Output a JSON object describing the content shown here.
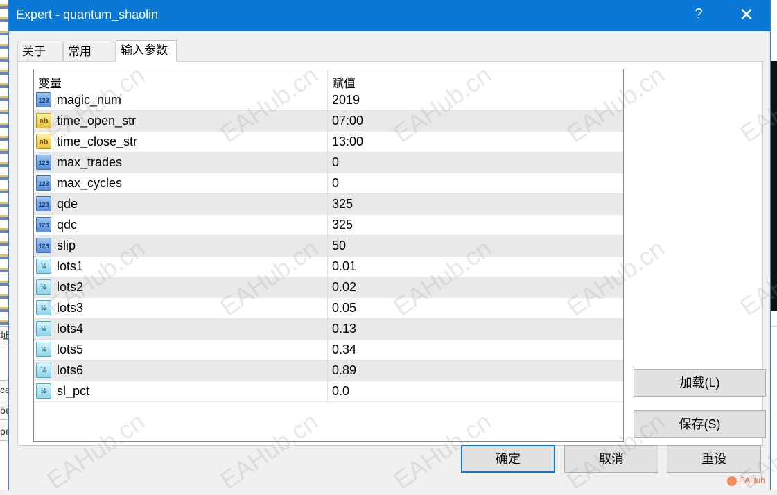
{
  "window": {
    "title": "Expert - quantum_shaolin",
    "help": "?",
    "close": "✕"
  },
  "tabs": [
    {
      "label": "关于"
    },
    {
      "label": "常用"
    },
    {
      "label": "输入参数"
    }
  ],
  "grid": {
    "headers": {
      "variable": "变量",
      "value": "赋值"
    },
    "rows": [
      {
        "type": "int",
        "icon": "123",
        "name": "magic_num",
        "value": "2019"
      },
      {
        "type": "string",
        "icon": "ab",
        "name": "time_open_str",
        "value": "07:00"
      },
      {
        "type": "string",
        "icon": "ab",
        "name": "time_close_str",
        "value": "13:00"
      },
      {
        "type": "int",
        "icon": "123",
        "name": "max_trades",
        "value": "0"
      },
      {
        "type": "int",
        "icon": "123",
        "name": "max_cycles",
        "value": "0"
      },
      {
        "type": "int",
        "icon": "123",
        "name": "qde",
        "value": "325"
      },
      {
        "type": "int",
        "icon": "123",
        "name": "qdc",
        "value": "325"
      },
      {
        "type": "int",
        "icon": "123",
        "name": "slip",
        "value": "50"
      },
      {
        "type": "double",
        "icon": "½",
        "name": "lots1",
        "value": "0.01"
      },
      {
        "type": "double",
        "icon": "½",
        "name": "lots2",
        "value": "0.02"
      },
      {
        "type": "double",
        "icon": "½",
        "name": "lots3",
        "value": "0.05"
      },
      {
        "type": "double",
        "icon": "½",
        "name": "lots4",
        "value": "0.13"
      },
      {
        "type": "double",
        "icon": "½",
        "name": "lots5",
        "value": "0.34"
      },
      {
        "type": "double",
        "icon": "½",
        "name": "lots6",
        "value": "0.89"
      },
      {
        "type": "double",
        "icon": "½",
        "name": "sl_pct",
        "value": "0.0"
      }
    ]
  },
  "buttons": {
    "load": "加载(L)",
    "save": "保存(S)",
    "ok": "确定",
    "cancel": "取消",
    "reset": "重设"
  },
  "watermark": "EAHub.cn",
  "corner_logo": "EAHub",
  "background": {
    "left_stubs": [
      "ce",
      "be",
      "be"
    ],
    "left_tab": "址"
  },
  "colors": {
    "titlebar": "#0a78d7",
    "alt_row": "#e9e9e9",
    "primary_border": "#0a78d7"
  }
}
